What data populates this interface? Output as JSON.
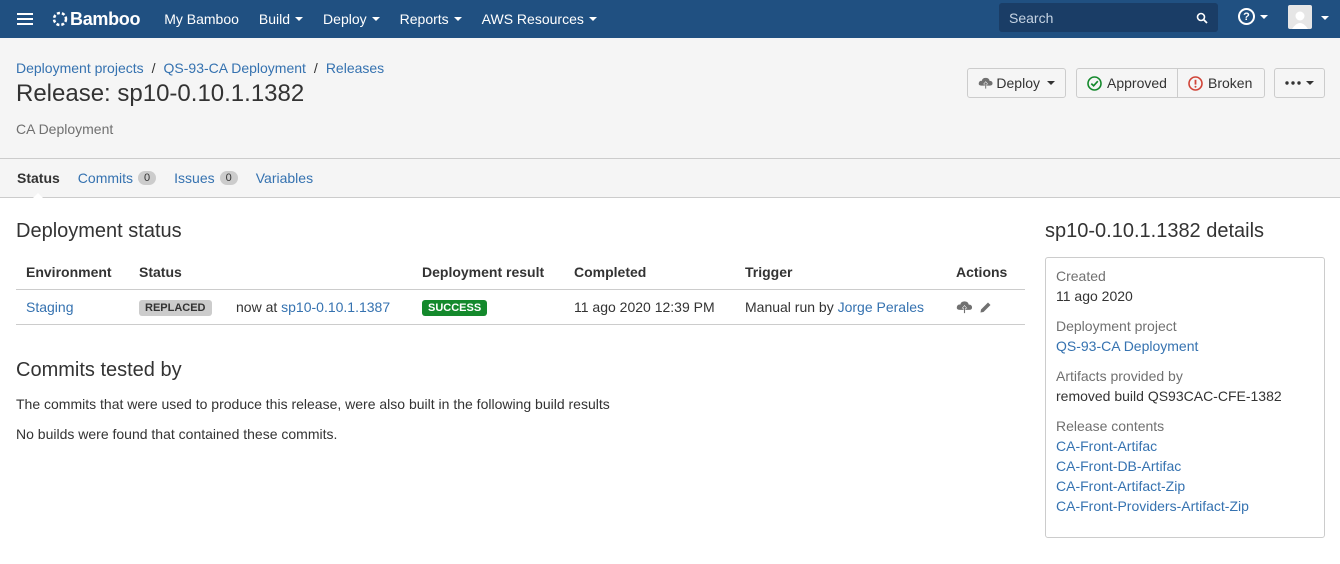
{
  "nav": {
    "logo": "Bamboo",
    "items": [
      "My Bamboo",
      "Build",
      "Deploy",
      "Reports",
      "AWS Resources"
    ],
    "search_placeholder": "Search"
  },
  "header": {
    "breadcrumb": [
      "Deployment projects",
      "QS-93-CA Deployment",
      "Releases"
    ],
    "title": "Release: sp10-0.10.1.1382",
    "subtitle": "CA Deployment",
    "buttons": {
      "deploy": "Deploy",
      "approved": "Approved",
      "broken": "Broken"
    }
  },
  "tabs": [
    {
      "label": "Status"
    },
    {
      "label": "Commits",
      "count": "0"
    },
    {
      "label": "Issues",
      "count": "0"
    },
    {
      "label": "Variables"
    }
  ],
  "status": {
    "title": "Deployment status",
    "columns": [
      "Environment",
      "Status",
      "",
      "Deployment result",
      "Completed",
      "Trigger",
      "Actions"
    ],
    "row": {
      "environment": "Staging",
      "status": "REPLACED",
      "now_prefix": "now at",
      "now_release": "sp10-0.10.1.1387",
      "result": "SUCCESS",
      "completed": "11 ago 2020 12:39 PM",
      "trigger_prefix": "Manual run by",
      "trigger_user": "Jorge Perales"
    }
  },
  "commits": {
    "title": "Commits tested by",
    "text": "The commits that were used to produce this release, were also built in the following build results",
    "none": "No builds were found that contained these commits."
  },
  "sidebar": {
    "title": "sp10-0.10.1.1382 details",
    "created_label": "Created",
    "created_value": "11 ago 2020",
    "project_label": "Deployment project",
    "project_value": "QS-93-CA Deployment",
    "artifacts_label": "Artifacts provided by",
    "artifacts_value": "removed build QS93CAC-CFE-1382",
    "contents_label": "Release contents",
    "contents": [
      "CA-Front-Artifac",
      "CA-Front-DB-Artifac",
      "CA-Front-Artifact-Zip",
      "CA-Front-Providers-Artifact-Zip"
    ]
  },
  "colors": {
    "nav_bg": "#205081",
    "link": "#3572b0",
    "success": "#14892c",
    "error": "#d04437"
  }
}
